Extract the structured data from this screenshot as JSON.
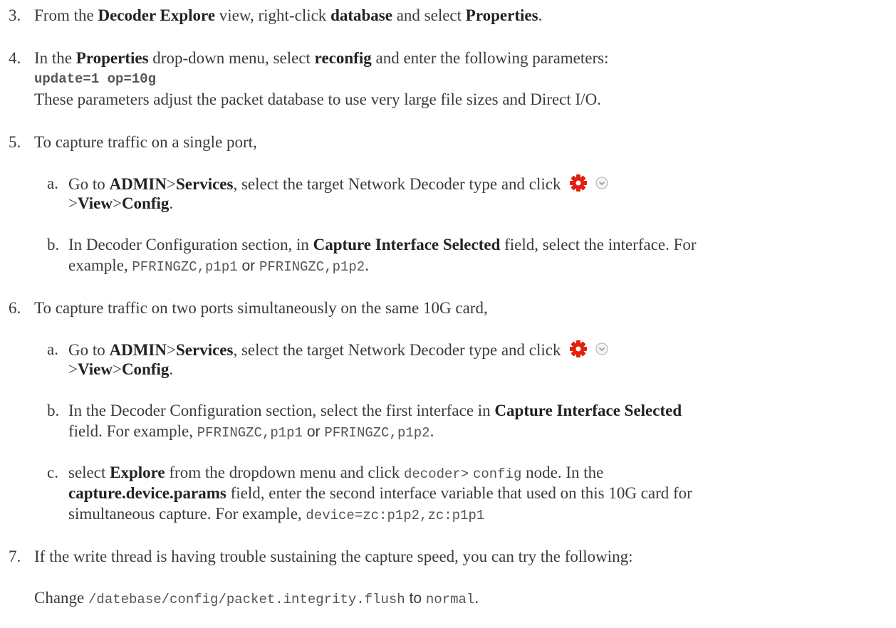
{
  "s3": {
    "num": "3.",
    "t1": "From the ",
    "b1": "Decoder Explore",
    "t2": " view, right-click ",
    "b2": "database",
    "t3": " and select ",
    "b3": "Properties",
    "t4": "."
  },
  "s4": {
    "num": "4.",
    "t1": "In the ",
    "b1": "Properties",
    "t2": " drop-down menu, select ",
    "b2": "reconfig",
    "t3": " and enter the following parameters:",
    "code": "update=1 op=10g",
    "note": "These parameters adjust the packet database to use very large file sizes and Direct I/O."
  },
  "s5": {
    "num": "5.",
    "text": "To capture traffic on a single port,",
    "a": {
      "num": "a.",
      "t1": "Go to ",
      "b1": "ADMIN",
      "t2": ">",
      "b2": "Services",
      "t3": ", select the target Network Decoder type and click ",
      "t4": ">",
      "b3": "View",
      "t5": ">",
      "b4": "Config",
      "t6": "."
    },
    "b": {
      "num": "b.",
      "t1": "In Decoder Configuration section, in ",
      "b1": "Capture Interface Selected",
      "t2": " field, select the interface. For",
      "t3": "example, ",
      "c1": "PFRINGZC,p1p1",
      "t4": " or ",
      "c2": "PFRINGZC,p1p2",
      "t5": "."
    }
  },
  "s6": {
    "num": "6.",
    "text": "To capture traffic on two ports simultaneously on the same 10G card,",
    "a": {
      "num": "a.",
      "t1": "Go to ",
      "b1": "ADMIN",
      "t2": ">",
      "b2": "Services",
      "t3": ", select the target Network Decoder type and click ",
      "t4": ">",
      "b3": "View",
      "t5": ">",
      "b4": "Config",
      "t6": "."
    },
    "b": {
      "num": "b.",
      "t1": "In the Decoder Configuration section, select the first interface in ",
      "b1": "Capture Interface Selected",
      "t2": "field. For example, ",
      "c1": "PFRINGZC,p1p1",
      "t3": " or ",
      "c2": "PFRINGZC,p1p2",
      "t4": "."
    },
    "c": {
      "num": "c.",
      "t1": "select ",
      "b1": "Explore",
      "t2": " from the dropdown menu and click ",
      "c1": "decoder>",
      "c2": "config",
      "t3": " node. In the",
      "b2": "capture.device.params",
      "t4": " field, enter the second interface variable that used on this 10G card for",
      "t5": "simultaneous capture. For example, ",
      "c3": "device=zc:p1p2,zc:p1p1"
    }
  },
  "s7": {
    "num": "7.",
    "text": "If the write thread is having trouble sustaining the capture speed, you can try the following:",
    "t1": "Change ",
    "c1": "/datebase/config/packet.integrity.flush",
    "t2": " to ",
    "c2": "normal",
    "t3": "."
  },
  "icons": {
    "gear": "gear-icon",
    "dropdown": "chevron-down-circle-icon",
    "gear_color": "#e02010"
  }
}
